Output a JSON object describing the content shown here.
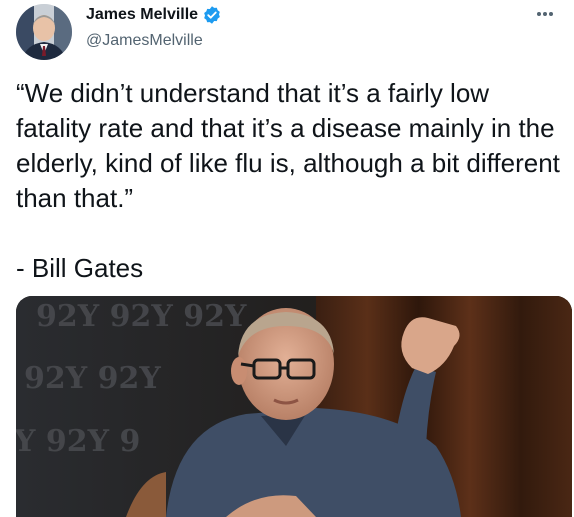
{
  "author": {
    "name": "James Melville",
    "handle": "@JamesMelville",
    "verified": true
  },
  "tweet": {
    "text": "“We didn’t understand that it’s a fairly low fatality rate and that it’s a disease mainly in the elderly, kind of like flu is, although a bit different than that.”\n\n- Bill Gates"
  },
  "media": {
    "backdrop_text_rows": [
      "92Y  92Y  92Y",
      "92Y  92Y",
      "Y  92Y  9"
    ]
  },
  "colors": {
    "verified_blue": "#1d9bf0",
    "text_primary": "#0f1419",
    "text_secondary": "#536471"
  },
  "icons": {
    "verified": "verified-badge-icon",
    "more": "more-options-icon"
  }
}
